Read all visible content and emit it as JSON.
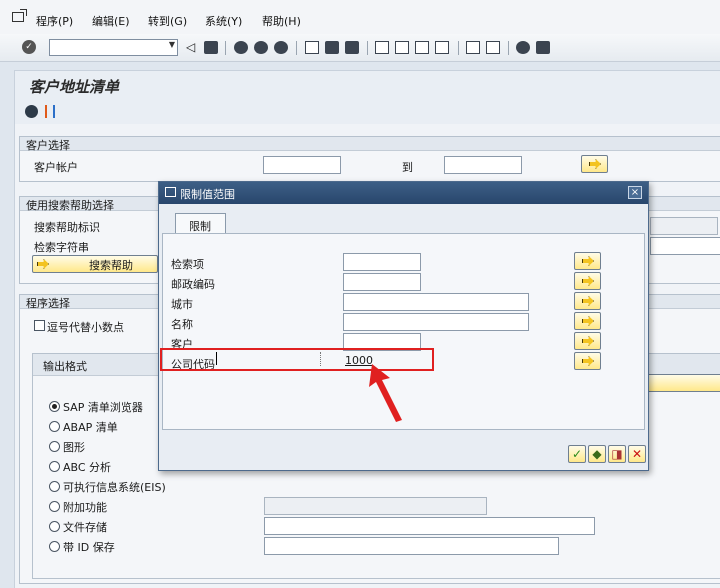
{
  "menu": [
    "程序(P)",
    "编辑(E)",
    "转到(G)",
    "系统(Y)",
    "帮助(H)"
  ],
  "page": {
    "title": "客户地址清单"
  },
  "customer_selection": {
    "title": "客户选择",
    "account_label": "客户帐户",
    "to_label": "到"
  },
  "search_help_selection": {
    "title": "使用搜索帮助选择",
    "id_label": "搜索帮助标识",
    "string_label": "检索字符串",
    "button_label": "搜索帮助"
  },
  "program_selection": {
    "title": "程序选择",
    "comma_checkbox_label": "逗号代替小数点",
    "output_format": {
      "title": "输出格式",
      "options": [
        "SAP 清单浏览器",
        "ABAP 清单",
        "图形",
        "ABC 分析",
        "可执行信息系统(EIS)",
        "附加功能",
        "文件存储",
        "带 ID 保存"
      ],
      "selected": "SAP 清单浏览器"
    }
  },
  "dialog": {
    "title": "限制值范围",
    "tab_label": "限制",
    "fields": [
      {
        "label": "检索项",
        "value": ""
      },
      {
        "label": "邮政编码",
        "value": ""
      },
      {
        "label": "城市",
        "value": ""
      },
      {
        "label": "名称",
        "value": ""
      },
      {
        "label": "客户",
        "value": ""
      },
      {
        "label": "公司代码",
        "value": "1000"
      }
    ]
  },
  "colors": {
    "highlight": "#e02020",
    "dialog_title_bg": "#28466c"
  }
}
